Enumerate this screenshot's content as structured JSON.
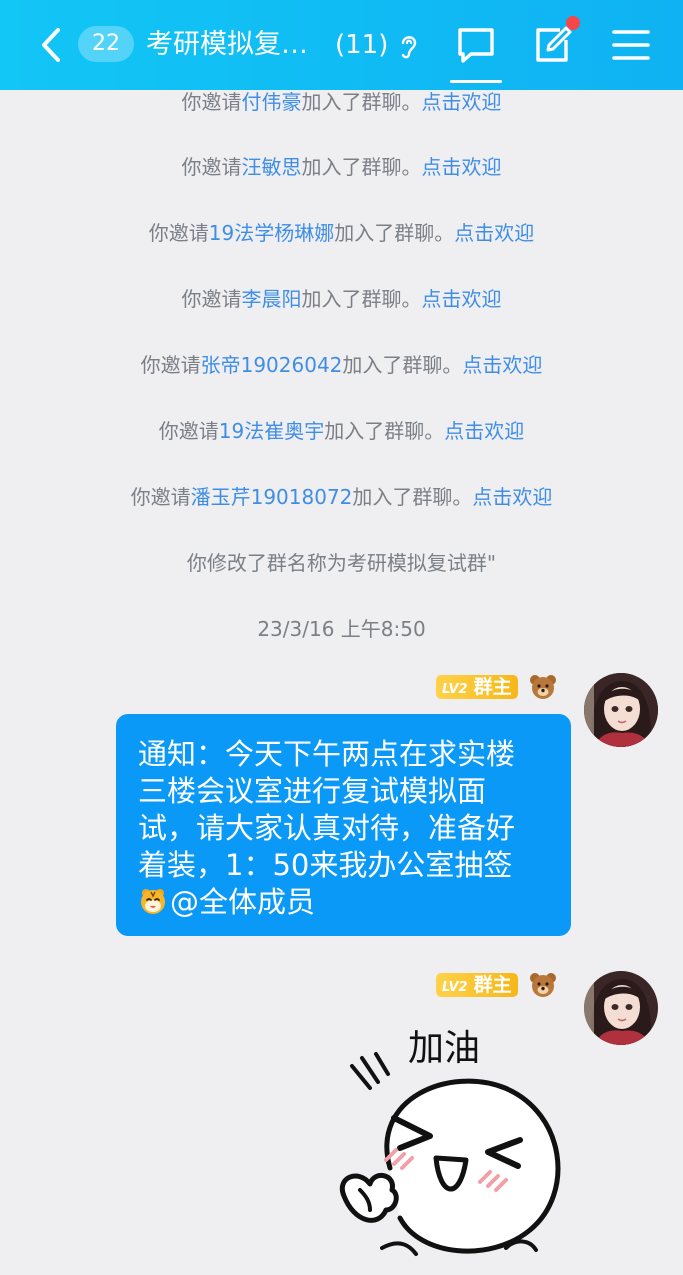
{
  "header": {
    "unread_count": "22",
    "title": "考研模拟复…",
    "member_count": "(11)",
    "icons": [
      "back-arrow-icon",
      "ear-icon",
      "chat-icon",
      "edit-icon",
      "menu-icon"
    ],
    "colors": {
      "bar": "#12c6f6",
      "notification_dot": "#f5474a"
    }
  },
  "messages": {
    "invites": [
      {
        "prefix": "你邀请",
        "name": "付伟豪",
        "suffix": "加入了群聊。",
        "action": "点击欢迎"
      },
      {
        "prefix": "你邀请",
        "name": "汪敏思",
        "suffix": "加入了群聊。",
        "action": "点击欢迎"
      },
      {
        "prefix": "你邀请",
        "name": "19法学杨琳娜",
        "suffix": "加入了群聊。",
        "action": "点击欢迎"
      },
      {
        "prefix": "你邀请",
        "name": "李晨阳",
        "suffix": "加入了群聊。",
        "action": "点击欢迎"
      },
      {
        "prefix": "你邀请",
        "name": "张帝19026042",
        "suffix": "加入了群聊。",
        "action": "点击欢迎"
      },
      {
        "prefix": "你邀请",
        "name": "19法崔奥宇",
        "suffix": "加入了群聊。",
        "action": "点击欢迎"
      },
      {
        "prefix": "你邀请",
        "name": "潘玉芹19018072",
        "suffix": "加入了群聊。",
        "action": "点击欢迎"
      }
    ],
    "rename_notice": "你修改了群名称为考研模拟复试群\"",
    "timestamp": "23/3/16 上午8:50",
    "chat": [
      {
        "level": "LV2",
        "role": "群主",
        "lines": [
          "通知：今天下午两点在求实楼",
          "三楼会议室进行复试模拟面",
          "试，请大家认真对待，准备好",
          "着装，1：50来我办公室抽签"
        ],
        "mention": "@全体成员"
      },
      {
        "level": "LV2",
        "role": "群主",
        "sticker_text": "加油"
      }
    ],
    "colors": {
      "bubble": "#0a99f6",
      "link": "#3f8ee6",
      "badge": "#f6b719"
    }
  }
}
